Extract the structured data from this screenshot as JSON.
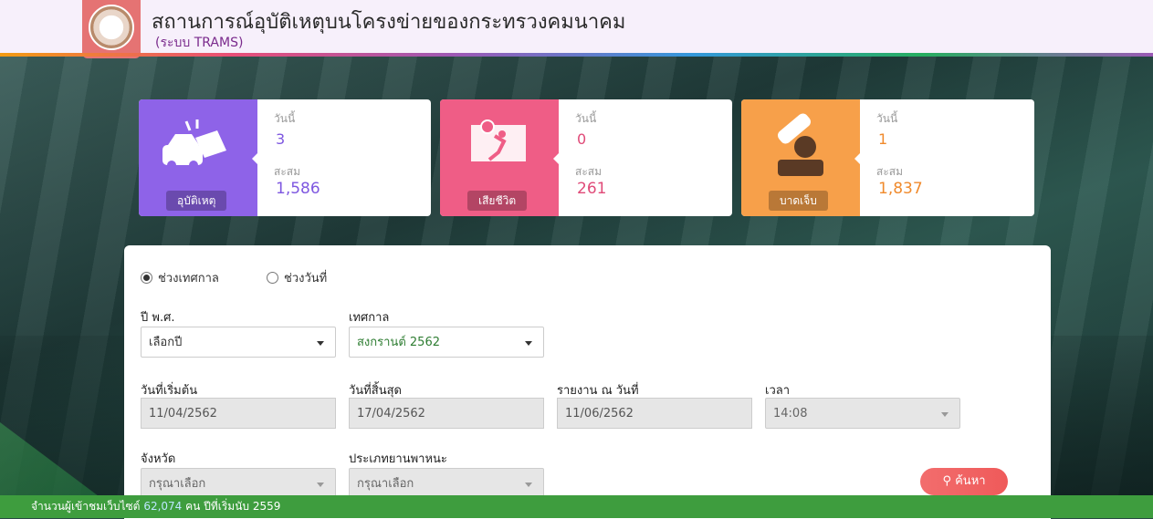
{
  "header": {
    "title": "สถานการณ์อุบัติเหตุบนโครงข่ายของกระทรวงคมนาคม",
    "subtitle": "(ระบบ TRAMS)"
  },
  "cards": [
    {
      "label": "อุบัติเหตุ",
      "today_label": "วันนี้",
      "today": "3",
      "total_label": "สะสม",
      "total": "1,586",
      "color": "#8e63e8",
      "icon": "car-crash-icon"
    },
    {
      "label": "เสียชีวิต",
      "today_label": "วันนี้",
      "today": "0",
      "total_label": "สะสม",
      "total": "261",
      "color": "#ef5d86",
      "icon": "fatality-icon"
    },
    {
      "label": "บาดเจ็บ",
      "today_label": "วันนี้",
      "today": "1",
      "total_label": "สะสม",
      "total": "1,837",
      "color": "#f7a04a",
      "icon": "injury-icon"
    }
  ],
  "form": {
    "radio_festival": "ช่วงเทศกาล",
    "radio_date": "ช่วงวันที่",
    "year_label": "ปี พ.ศ.",
    "year_value": "เลือกปี",
    "festival_label": "เทศกาล",
    "festival_value": "สงกรานต์ 2562",
    "start_label": "วันที่เริ่มต้น",
    "start_value": "11/04/2562",
    "end_label": "วันที่สิ้นสุด",
    "end_value": "17/04/2562",
    "report_label": "รายงาน ณ วันที่",
    "report_value": "11/06/2562",
    "time_label": "เวลา",
    "time_value": "14:08",
    "province_label": "จังหวัด",
    "province_value": "กรุณาเลือก",
    "vehicle_label": "ประเภทยานพาหนะ",
    "vehicle_value": "กรุณาเลือก",
    "search_label": "ค้นหา"
  },
  "footer": {
    "prefix": "จำนวนผู้เข้าชมเว็บไซต์",
    "count": "62,074",
    "unit": "คน",
    "since": "ปีที่เริ่มนับ 2559"
  },
  "colors": {
    "accent_green": "#3e9d3e",
    "card_purple": "#8e63e8",
    "card_pink": "#ef5d86",
    "card_orange": "#f7a04a"
  }
}
